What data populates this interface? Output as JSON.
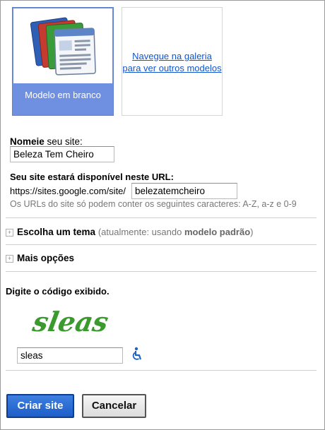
{
  "templates": {
    "blank": {
      "label": "Modelo em branco",
      "icon": "blank-template-icon"
    },
    "gallery": {
      "link_text": "Navegue na galeria para ver outros modelos"
    }
  },
  "site_name": {
    "label_bold": "Nomeie",
    "label_rest": " seu site:",
    "value": "Beleza Tem Cheiro"
  },
  "url": {
    "label": "Seu site estará disponível neste URL:",
    "prefix": "https://sites.google.com/site/",
    "value": "belezatemcheiro",
    "hint": "Os URLs do site só podem conter os seguintes caracteres: A-Z, a-z e 0-9"
  },
  "theme": {
    "title": "Escolha um tema",
    "note_prefix": "(atualmente: usando ",
    "note_bold": "modelo padrão",
    "note_suffix": ")"
  },
  "more_options": {
    "title": "Mais opções"
  },
  "captcha": {
    "prompt": "Digite o código exibido.",
    "image_text": "sleas",
    "value": "sleas",
    "audio_icon": "accessibility-icon"
  },
  "buttons": {
    "create": "Criar site",
    "cancel": "Cancelar"
  },
  "colors": {
    "selected_tile": "#6f8fe0",
    "link": "#1155cc",
    "primary_button": "#2a6ad8"
  }
}
